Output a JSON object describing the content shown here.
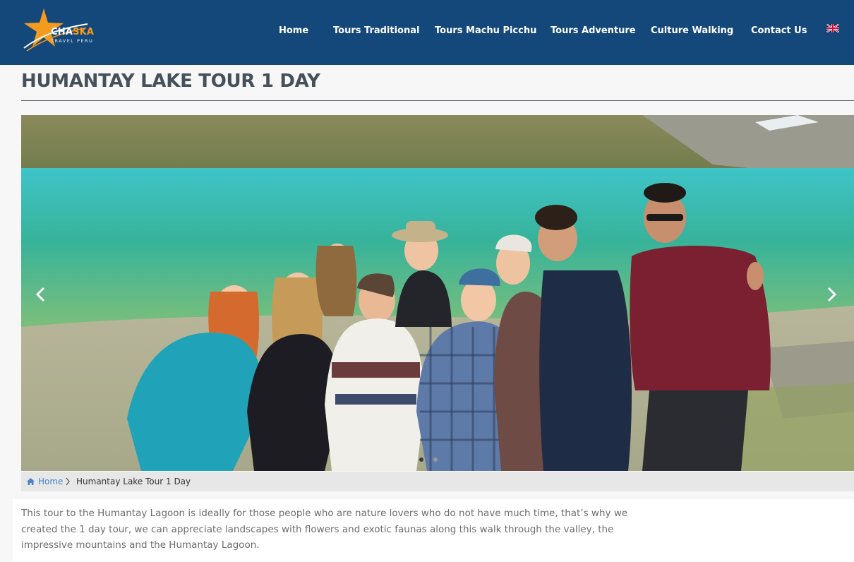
{
  "brand": {
    "name_part1": "CHA",
    "name_part2": "SKA",
    "tagline": "TRAVEL PERU",
    "colors": {
      "header_bg": "#15487a",
      "accent_orange": "#f39a1f"
    }
  },
  "nav": {
    "items": [
      {
        "label": "Home"
      },
      {
        "label": "Tours Traditional"
      },
      {
        "label": "Tours Machu Picchu"
      },
      {
        "label": "Tours Adventure"
      },
      {
        "label": "Culture Walking"
      },
      {
        "label": "Contact Us"
      }
    ],
    "language_icon": "uk-flag-icon"
  },
  "page": {
    "title": "HUMANTAY LAKE TOUR 1 DAY"
  },
  "slider": {
    "image": "group-photo-at-humantay-lake",
    "prev_icon": "chevron-left-icon",
    "next_icon": "chevron-right-icon",
    "slide_count": 2,
    "active_slide": 1
  },
  "breadcrumb": {
    "home_icon": "home-icon",
    "home_label": "Home",
    "separator_icon": "chevron-right-icon",
    "current_label": "Humantay Lake Tour 1 Day"
  },
  "content": {
    "description_lines": [
      "This tour to the Humantay Lagoon is ideally for those people who are nature lovers who do not have much time, that’s why we",
      "created the 1 day tour, we can appreciate landscapes with flowers and exotic faunas along this walk through the valley, the",
      "impressive mountains and the Humantay Lagoon."
    ]
  }
}
